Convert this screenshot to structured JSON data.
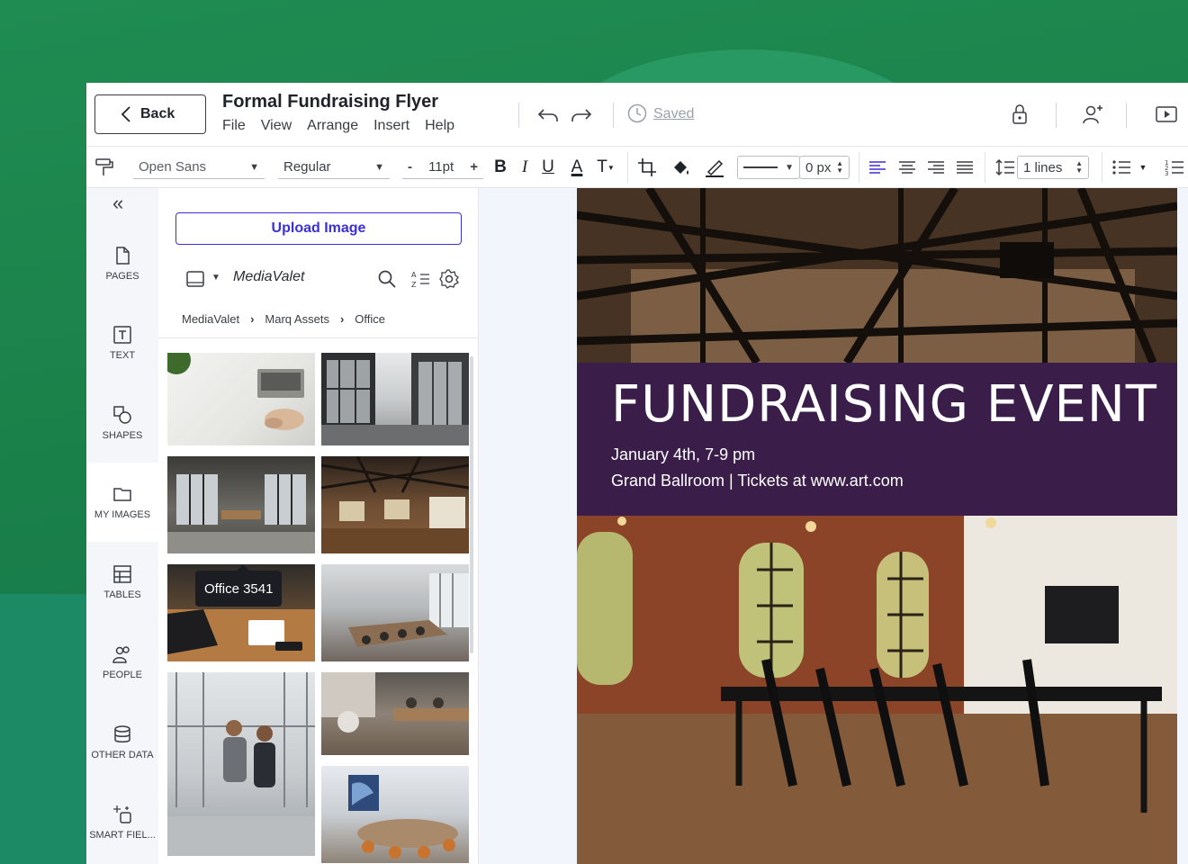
{
  "header": {
    "back_label": "Back",
    "doc_title": "Formal Fundraising Flyer",
    "menu": [
      "File",
      "View",
      "Arrange",
      "Insert",
      "Help"
    ],
    "saved_label": "Saved"
  },
  "toolbar": {
    "font_family": "Open Sans",
    "font_weight": "Regular",
    "font_size": "11pt",
    "bold": "B",
    "italic": "I",
    "underline": "U",
    "text_color": "A",
    "text_transform": "T",
    "minus": "-",
    "plus": "+",
    "stroke_width": "0 px",
    "line_spacing": "1 lines"
  },
  "rail": {
    "items": [
      "PAGES",
      "TEXT",
      "SHAPES",
      "MY IMAGES",
      "TABLES",
      "PEOPLE",
      "OTHER DATA",
      "SMART FIEL..."
    ],
    "active": "MY IMAGES"
  },
  "panel": {
    "upload_label": "Upload Image",
    "source_name": "MediaValet",
    "breadcrumbs": [
      "MediaValet",
      "Marq Assets",
      "Office"
    ],
    "tooltip": "Office 3541"
  },
  "poster": {
    "title": "FUNDRAISING EVENT",
    "line1": "January 4th, 7-9 pm",
    "line2": "Grand Ballroom | Tickets at www.art.com"
  },
  "colors": {
    "accent": "#3b2fd6",
    "band": "#3a1e49",
    "background_green": "#1f8c52"
  }
}
